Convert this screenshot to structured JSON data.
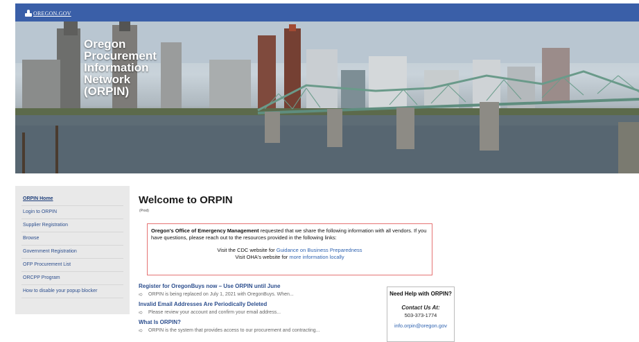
{
  "header": {
    "logo_text": "OREGON.GOV",
    "brand_color": "#3a5fa8"
  },
  "hero": {
    "title_lines": [
      "Oregon",
      "Procurement",
      "Information",
      "Network",
      "(ORPIN)"
    ]
  },
  "sidebar": {
    "items": [
      {
        "label": "ORPIN Home",
        "active": true
      },
      {
        "label": "Login to ORPIN"
      },
      {
        "label": "Supplier Registration"
      },
      {
        "label": "Browse"
      },
      {
        "label": "Government Registration"
      },
      {
        "label": "OFP Procurement List"
      },
      {
        "label": "ORCPP Program"
      },
      {
        "label": "How to disable your popup blocker"
      }
    ]
  },
  "main": {
    "title": "Welcome to ORPIN",
    "environment": "(Prod)",
    "notice": {
      "org": "Oregon's Office of Emergency Management",
      "text": " requested that we share the following information with all vendors. If you have questions, please reach out to the resources provided in the following links:",
      "line1_prefix": "Visit the CDC website for ",
      "line1_link": "Guidance on Business Preparedness",
      "line2_prefix": "Visit OHA's website for ",
      "line2_link": "more information locally",
      "border_color": "#e57373"
    },
    "news": [
      {
        "heading": "Register for OregonBuys now – Use ORPIN until June",
        "body": "ORPIN is being replaced on July 1, 2021 with OregonBuys. When..."
      },
      {
        "heading": "Invalid Email Addresses Are Periodically Deleted",
        "body": "Please review your account and confirm your email address..."
      },
      {
        "heading": "What Is ORPIN?",
        "body": "ORPIN is the system that provides access to our procurement and contracting..."
      }
    ]
  },
  "help": {
    "title": "Need Help with ORPIN?",
    "contact_label": "Contact Us At:",
    "phone": "503-373-1774",
    "email": "info.orpin@oregon.gov"
  }
}
